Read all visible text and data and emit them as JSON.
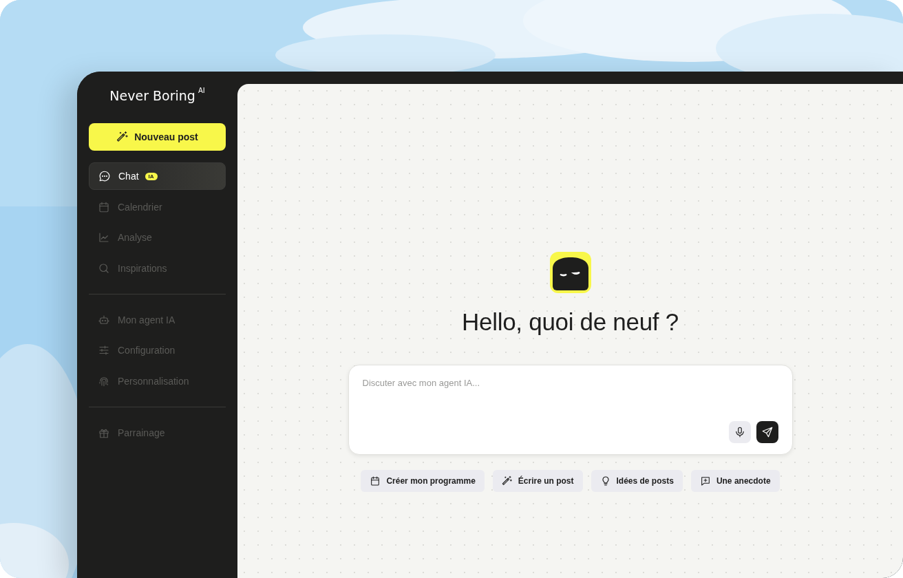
{
  "brand": {
    "name": "Never Boring",
    "superscript": "AI"
  },
  "new_post_button": {
    "label": "Nouveau post"
  },
  "sidebar": {
    "groups": [
      {
        "items": [
          {
            "label": "Chat",
            "badge": "IA",
            "selected": true
          },
          {
            "label": "Calendrier",
            "selected": false
          },
          {
            "label": "Analyse",
            "selected": false
          },
          {
            "label": "Inspirations",
            "selected": false
          }
        ]
      },
      {
        "items": [
          {
            "label": "Mon agent IA",
            "selected": false
          },
          {
            "label": "Configuration",
            "selected": false
          },
          {
            "label": "Personnalisation",
            "selected": false
          }
        ]
      },
      {
        "items": [
          {
            "label": "Parrainage",
            "selected": false
          }
        ]
      }
    ]
  },
  "greeting": "Hello, quoi de neuf ?",
  "chat_input": {
    "placeholder": "Discuter avec mon agent IA..."
  },
  "suggestions": [
    {
      "label": "Créer mon programme"
    },
    {
      "label": "Écrire un post"
    },
    {
      "label": "Idées de posts"
    },
    {
      "label": "Une anecdote"
    }
  ]
}
